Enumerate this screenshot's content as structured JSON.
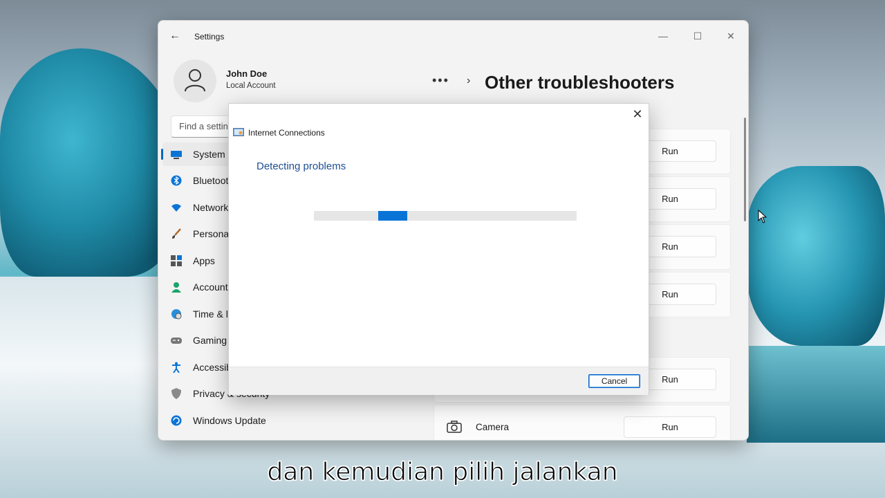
{
  "window": {
    "title": "Settings",
    "controls": [
      "minimize",
      "maximize",
      "close"
    ]
  },
  "profile": {
    "name": "John Doe",
    "account_type": "Local Account"
  },
  "breadcrumb": {
    "overflow": "•••",
    "separator": "›",
    "page_title": "Other troubleshooters"
  },
  "search": {
    "placeholder": "Find a setting"
  },
  "sidebar": {
    "items": [
      {
        "label": "System",
        "icon": "monitor-icon",
        "active": true
      },
      {
        "label": "Bluetooth & devices",
        "icon": "bluetooth-icon"
      },
      {
        "label": "Network & internet",
        "icon": "wifi-icon"
      },
      {
        "label": "Personalization",
        "icon": "brush-icon"
      },
      {
        "label": "Apps",
        "icon": "apps-icon"
      },
      {
        "label": "Accounts",
        "icon": "person-icon"
      },
      {
        "label": "Time & language",
        "icon": "globe-clock-icon"
      },
      {
        "label": "Gaming",
        "icon": "gamepad-icon"
      },
      {
        "label": "Accessibility",
        "icon": "accessibility-icon"
      },
      {
        "label": "Privacy & security",
        "icon": "shield-icon"
      },
      {
        "label": "Windows Update",
        "icon": "update-icon"
      }
    ]
  },
  "troubleshooters": {
    "run_label": "Run",
    "camera_label": "Camera"
  },
  "dialog": {
    "title": "Internet Connections",
    "status": "Detecting problems",
    "cancel_label": "Cancel",
    "close_glyph": "✕"
  },
  "caption": "dan kemudian pilih jalankan",
  "colors": {
    "accent": "#0067c0",
    "progress": "#0a74d6",
    "status_text": "#1e4f91"
  }
}
